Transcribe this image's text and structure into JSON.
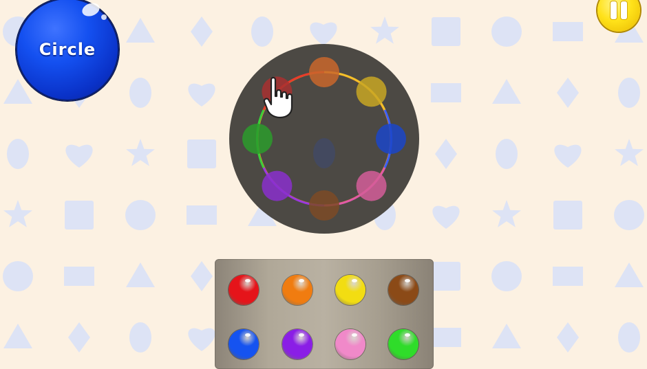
{
  "badge": {
    "label": "Circle",
    "shape": "circle",
    "color": "#1450f0"
  },
  "pause": {
    "icon": "pause-icon",
    "color": "#ffe21a"
  },
  "wheel": {
    "board_color": "#4c4944",
    "slots": [
      {
        "name": "orange",
        "color": "#c9662c",
        "filled": false
      },
      {
        "name": "yellow",
        "color": "#c8a623",
        "filled": false
      },
      {
        "name": "blue",
        "color": "#1b45c8",
        "filled": false
      },
      {
        "name": "pink",
        "color": "#d45d99",
        "filled": false
      },
      {
        "name": "brown",
        "color": "#7d4a26",
        "filled": false
      },
      {
        "name": "purple",
        "color": "#8a2fcc",
        "filled": false
      },
      {
        "name": "green",
        "color": "#2c9b2c",
        "filled": false
      },
      {
        "name": "red",
        "color": "#a83030",
        "filled": false
      }
    ]
  },
  "palette": {
    "balls": [
      {
        "name": "red",
        "color": "#e5141a"
      },
      {
        "name": "orange",
        "color": "#f07c10"
      },
      {
        "name": "yellow",
        "color": "#f2dd12"
      },
      {
        "name": "brown",
        "color": "#8b4a17"
      },
      {
        "name": "blue",
        "color": "#1553f0"
      },
      {
        "name": "purple",
        "color": "#8a1ee6"
      },
      {
        "name": "pink",
        "color": "#f089c9"
      },
      {
        "name": "green",
        "color": "#2fdc2a"
      }
    ]
  },
  "background": {
    "shape_color": "#dde3f5",
    "shapes": [
      "circle",
      "rectangle",
      "triangle",
      "diamond",
      "oval",
      "heart",
      "star",
      "square"
    ]
  }
}
